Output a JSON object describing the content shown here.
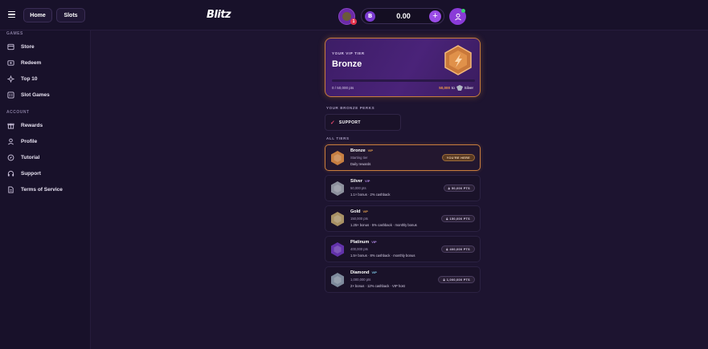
{
  "header": {
    "nav": [
      "Home",
      "Slots"
    ],
    "logo": "Blitz",
    "notifications": "1",
    "balance": "0.00",
    "currency_icon": "B"
  },
  "sidebar": {
    "games_label": "GAMES",
    "games": [
      {
        "label": "Store",
        "icon": "store-icon"
      },
      {
        "label": "Redeem",
        "icon": "redeem-icon"
      },
      {
        "label": "Top 10",
        "icon": "top10-icon"
      },
      {
        "label": "Slot Games",
        "icon": "slot-games-icon"
      }
    ],
    "account_label": "ACCOUNT",
    "account": [
      {
        "label": "Rewards",
        "icon": "gift-icon"
      },
      {
        "label": "Profile",
        "icon": "profile-icon"
      },
      {
        "label": "Tutorial",
        "icon": "compass-icon"
      },
      {
        "label": "Support",
        "icon": "headset-icon"
      },
      {
        "label": "Terms of Service",
        "icon": "document-icon"
      }
    ]
  },
  "vip": {
    "kicker": "YOUR VIP TIER",
    "tier": "Bronze",
    "progress": 0.0,
    "points": "0 / 50,000 pts",
    "need": "50,000",
    "to_label": "to",
    "next_tier": "Silver"
  },
  "perks": {
    "heading": "YOUR BRONZE PERKS",
    "items": [
      "SUPPORT"
    ]
  },
  "tiers": {
    "heading": "ALL TIERS",
    "vip_label": "VIP",
    "items": [
      {
        "name": "Bronze",
        "sub": "Starting tier",
        "perks": "Daily rewards",
        "tag": "YOU'RE HERE",
        "color": "#d98a44"
      },
      {
        "name": "Silver",
        "sub": "50,000 pts",
        "perks": "1.1× bonus · 2% cashback",
        "tag": "50,000 PTS",
        "color": "#9aa0aa"
      },
      {
        "name": "Gold",
        "sub": "150,000 pts",
        "perks": "1.25× bonus · 5% cashback · monthly bonus",
        "tag": "150,000 PTS",
        "color": "#b8a06a"
      },
      {
        "name": "Platinum",
        "sub": "400,000 pts",
        "perks": "1.5× bonus · 8% cashback · monthly bonus",
        "tag": "400,000 PTS",
        "color": "#6a36b8"
      },
      {
        "name": "Diamond",
        "sub": "1,000,000 pts",
        "perks": "2× bonus · 12% cashback · VIP host",
        "tag": "1,000,000 PTS",
        "color": "#8a98a8"
      }
    ]
  },
  "colors": {
    "accent": "#9a4ce6",
    "bronze": "#c77c3d",
    "background": "#1d1430"
  }
}
